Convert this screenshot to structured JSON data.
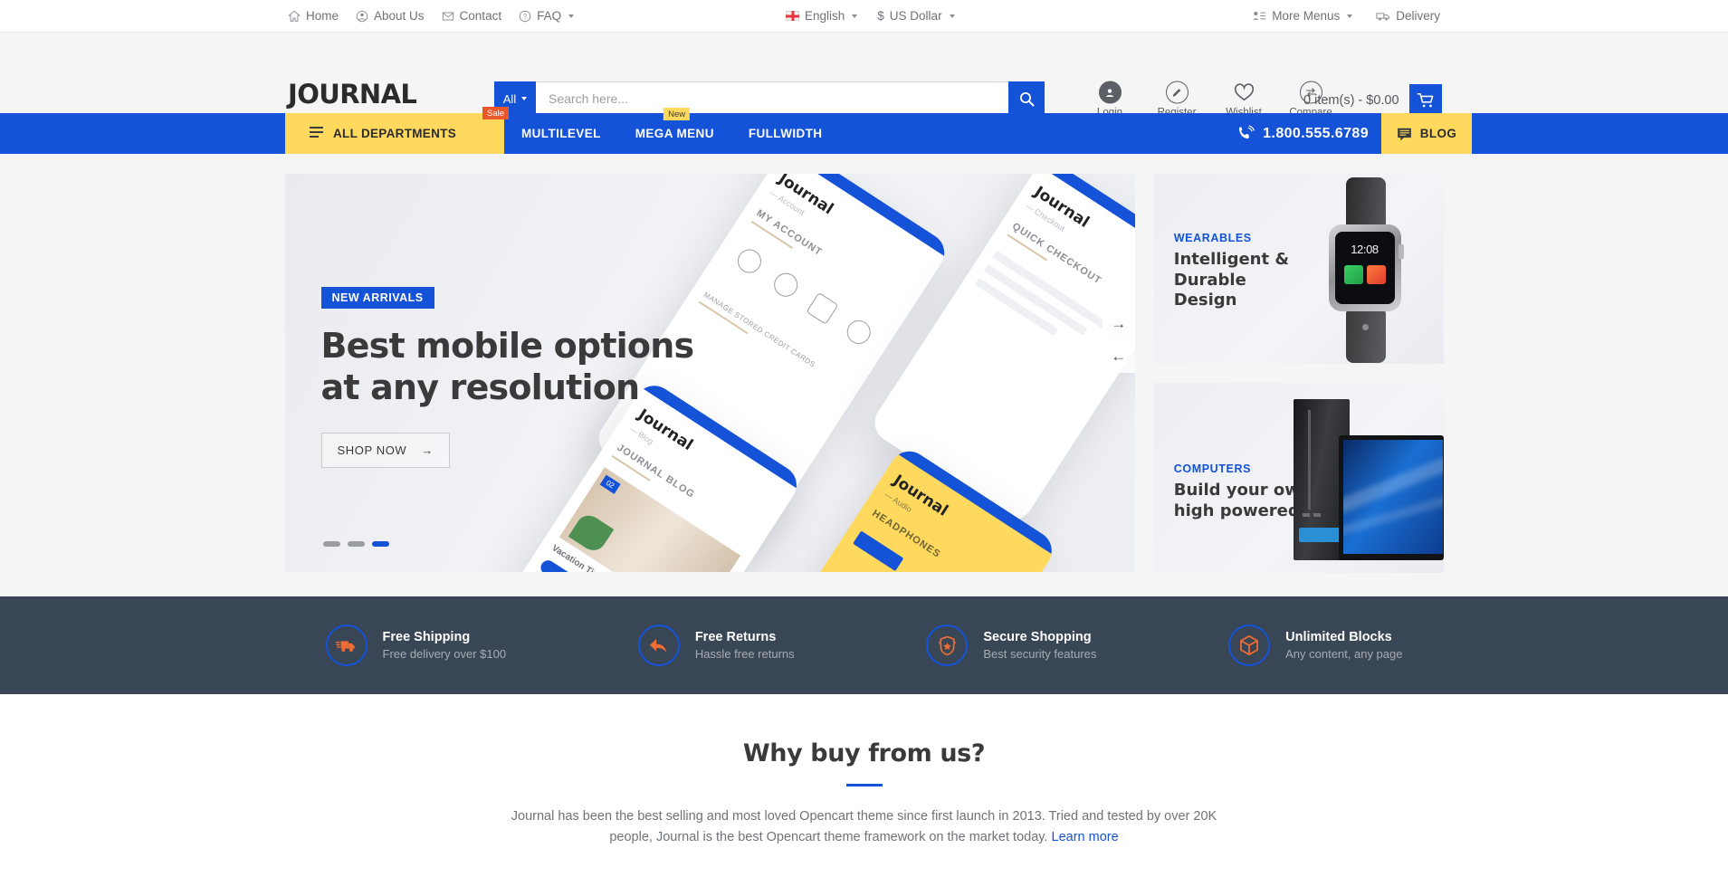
{
  "topbar": {
    "left_links": [
      {
        "label": "Home",
        "icon": "home-icon"
      },
      {
        "label": "About Us",
        "icon": "user-circle-icon"
      },
      {
        "label": "Contact",
        "icon": "envelope-icon"
      },
      {
        "label": "FAQ",
        "icon": "question-circle-icon",
        "caret": true
      }
    ],
    "language": "English",
    "currency": "US Dollar",
    "currency_symbol": "$",
    "more_menus": "More Menus",
    "delivery": "Delivery"
  },
  "header": {
    "logo": "JOURNAL",
    "search": {
      "category": "All",
      "placeholder": "Search here...",
      "value": ""
    },
    "icons": [
      {
        "label": "Login",
        "icon": "user-icon"
      },
      {
        "label": "Register",
        "icon": "pencil-icon"
      },
      {
        "label": "Wishlist",
        "icon": "heart-icon"
      },
      {
        "label": "Compare",
        "icon": "compare-arrows-icon"
      }
    ],
    "cart_total": "0 item(s) - $0.00"
  },
  "nav": {
    "departments": "ALL DEPARTMENTS",
    "departments_badge": "Sale",
    "links": [
      {
        "label": "MULTILEVEL",
        "badge": ""
      },
      {
        "label": "MEGA MENU",
        "badge": "New"
      },
      {
        "label": "FULLWIDTH",
        "badge": ""
      }
    ],
    "phone": "1.800.555.6789",
    "blog": "BLOG"
  },
  "slider": {
    "pill": "NEW ARRIVALS",
    "heading_line1": "Best mobile options",
    "heading_line2": "at any resolution",
    "cta": "SHOP NOW",
    "next_arrow": "→",
    "prev_arrow": "←",
    "dots": 3,
    "active_dot": 3,
    "phone_logo": "Journal",
    "phone_captions": [
      "MY ACCOUNT",
      "QUICK CHECKOUT",
      "JOURNAL BLOG",
      "HEADPHONES"
    ]
  },
  "side_banners": [
    {
      "label": "WEARABLES",
      "title_lines": [
        "Intelligent &",
        "Durable",
        "Design"
      ],
      "image": "smartwatch",
      "watch_time": "12:08"
    },
    {
      "label": "COMPUTERS",
      "title_lines": [
        "Build your own",
        "high powered PC"
      ],
      "image": "desktop-computer"
    }
  ],
  "features": [
    {
      "icon": "truck-icon",
      "title": "Free Shipping",
      "subtitle": "Free delivery over $100"
    },
    {
      "icon": "return-arrow-icon",
      "title": "Free Returns",
      "subtitle": "Hassle free returns"
    },
    {
      "icon": "shield-badge-icon",
      "title": "Secure Shopping",
      "subtitle": "Best security features"
    },
    {
      "icon": "cube-icon",
      "title": "Unlimited Blocks",
      "subtitle": "Any content, any page"
    }
  ],
  "why": {
    "title": "Why buy from us?",
    "body": "Journal has been the best selling and most loved Opencart theme since first launch in 2013. Tried and tested by over 20K people, Journal is the best Opencart theme framework on the market today.",
    "link": "Learn more"
  },
  "colors": {
    "accent_blue": "#1452d8",
    "accent_yellow": "#ffd95e",
    "sale_orange": "#e9572b",
    "dark_slate": "#394655",
    "feature_orange": "#ef6c33"
  }
}
